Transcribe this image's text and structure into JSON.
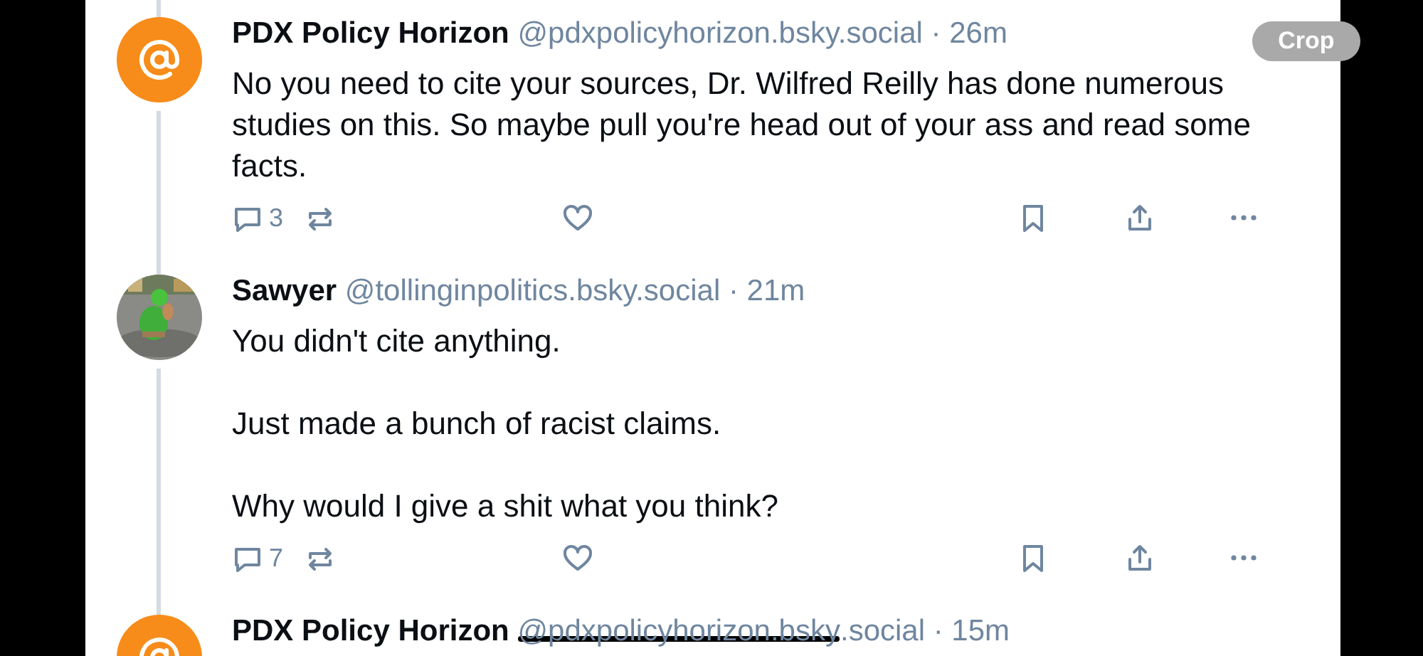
{
  "posts": [
    {
      "author": "PDX Policy Horizon",
      "avatar": {
        "kind": "logo"
      },
      "handle_parts": [
        {
          "text": "@pdxpolicyhorizon.bsky.social · 26m",
          "struck": false
        }
      ],
      "paragraphs": [
        "No you need to cite your sources, Dr. Wilfred Reilly has done numerous studies on this. So maybe pull you're head out of your ass and read some facts."
      ],
      "reply_count": "3"
    },
    {
      "author": "Sawyer",
      "avatar": {
        "kind": "picture"
      },
      "handle_parts": [
        {
          "text": "@tollinginpolitics.bsky.social · 21m",
          "struck": false
        }
      ],
      "paragraphs": [
        "You didn't cite anything.",
        "Just made a bunch of racist claims.",
        "Why would I give a shit what you think?"
      ],
      "reply_count": "7"
    },
    {
      "author": "PDX Policy Horizon",
      "avatar": {
        "kind": "logo"
      },
      "handle_parts": [
        {
          "text": "@pdxpolicyhorizon.bsky",
          "struck": true
        },
        {
          "text": ".social · 15m",
          "struck": false
        }
      ]
    }
  ],
  "overlay_button": "Crop"
}
